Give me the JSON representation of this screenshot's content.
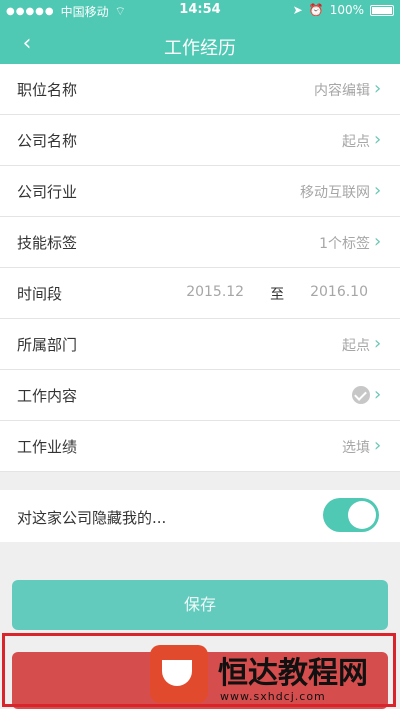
{
  "status_bar": {
    "carrier": "中国移动",
    "time": "14:54",
    "battery": "100%"
  },
  "nav": {
    "title": "工作经历",
    "back_glyph": "‹"
  },
  "fields": [
    {
      "label": "职位名称",
      "value": "内容编辑"
    },
    {
      "label": "公司名称",
      "value": "起点"
    },
    {
      "label": "公司行业",
      "value": "移动互联网"
    },
    {
      "label": "技能标签",
      "value": "1个标签"
    },
    {
      "label": "时间段",
      "start": "2015.12",
      "sep": "至",
      "end": "2016.10"
    },
    {
      "label": "所属部门",
      "value": "起点"
    },
    {
      "label": "工作内容",
      "icon": "check-circle-icon"
    },
    {
      "label": "工作业绩",
      "value": "选填"
    }
  ],
  "hide_toggle": {
    "label": "对这家公司隐藏我的...",
    "on": true
  },
  "buttons": {
    "save": "保存"
  },
  "watermark": {
    "text": "恒达教程网",
    "url": "www.sxhdcj.com"
  },
  "colors": {
    "accent": "#4fc8b4",
    "delete": "#d64d4d",
    "highlight": "#d9242b"
  }
}
